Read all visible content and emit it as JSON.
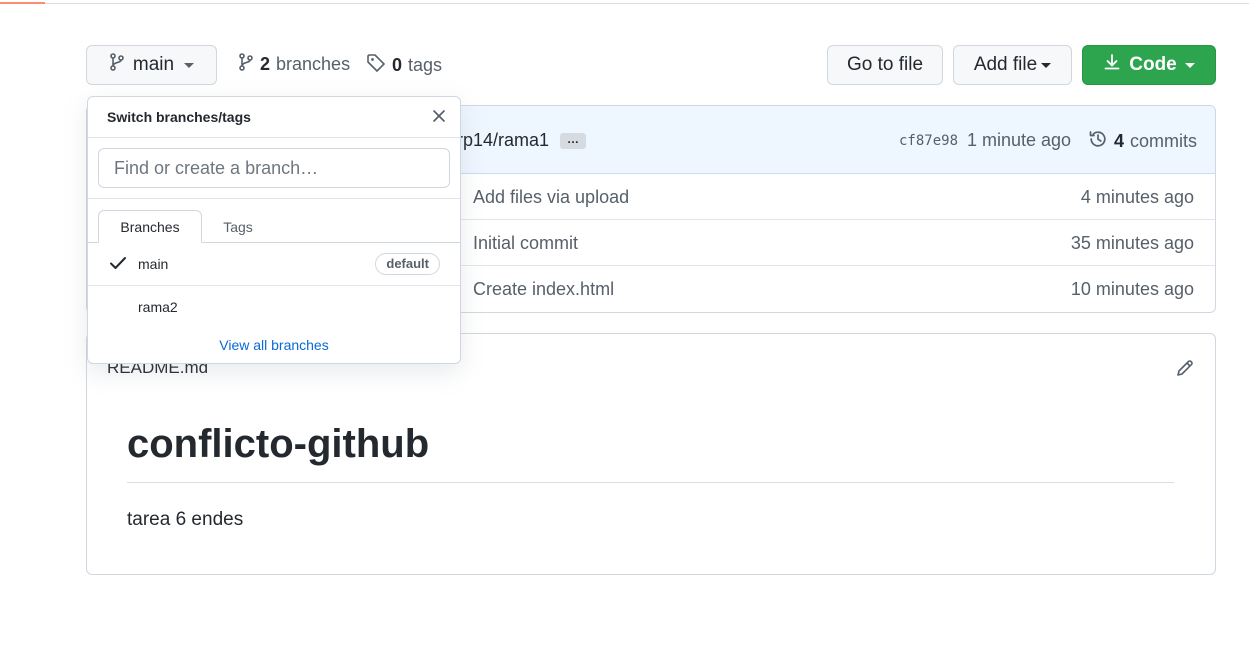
{
  "header": {
    "branch_button_label": "main",
    "branches_count": "2",
    "branches_label": "branches",
    "tags_count": "0",
    "tags_label": "tags",
    "go_to_file_label": "Go to file",
    "add_file_label": "Add file",
    "code_label": "Code"
  },
  "latest_commit": {
    "message_partial": "rp14/rama1",
    "ellipsis": "…",
    "sha": "cf87e98",
    "age": "1 minute ago",
    "commits_count": "4",
    "commits_label": "commits"
  },
  "files": [
    {
      "message": "Add files via upload",
      "age": "4 minutes ago"
    },
    {
      "message": "Initial commit",
      "age": "35 minutes ago"
    },
    {
      "message": "Create index.html",
      "age": "10 minutes ago"
    }
  ],
  "readme": {
    "file_name": "README.md",
    "heading": "conflicto-github",
    "paragraph": "tarea 6 endes"
  },
  "branch_dropdown": {
    "title": "Switch branches/tags",
    "search_placeholder": "Find or create a branch…",
    "tabs": [
      "Branches",
      "Tags"
    ],
    "branches": [
      {
        "name": "main",
        "badge": "default",
        "selected": true
      },
      {
        "name": "rama2",
        "badge": "",
        "selected": false
      }
    ],
    "view_all_label": "View all branches"
  },
  "colors": {
    "accent_green": "#2da44e",
    "link_blue": "#0969da",
    "commit_bar_bg": "#eef6ff"
  },
  "icons": [
    "git-branch-icon",
    "tag-icon",
    "download-icon",
    "history-icon",
    "pencil-icon",
    "close-icon",
    "check-icon",
    "caret-down-icon"
  ]
}
